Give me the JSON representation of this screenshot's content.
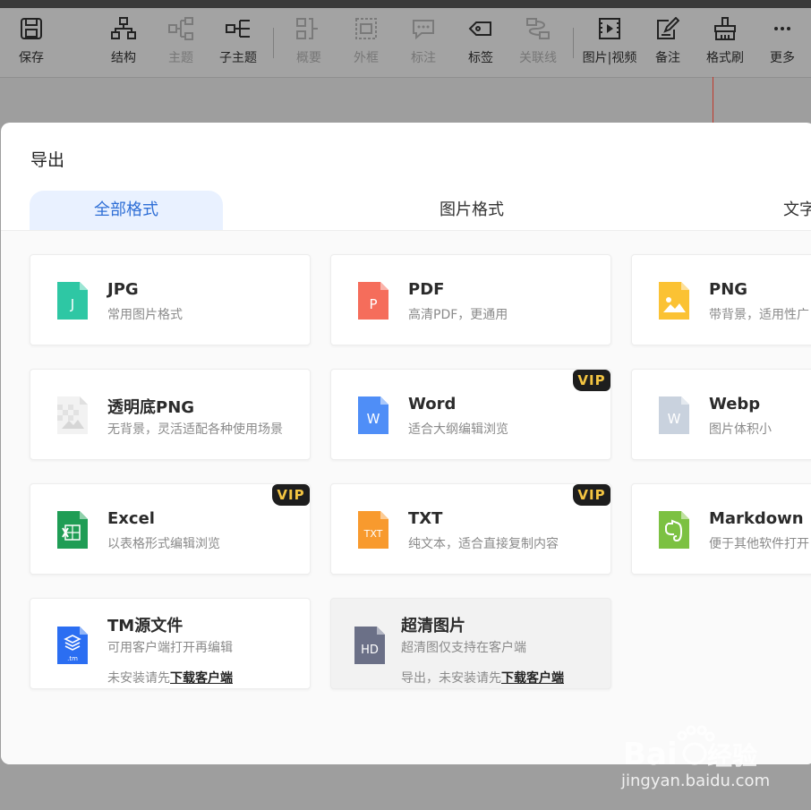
{
  "toolbar": {
    "items": [
      {
        "label": "保存",
        "icon": "save-icon",
        "enabled": true
      },
      {
        "label": "结构",
        "icon": "structure-icon",
        "enabled": true
      },
      {
        "label": "主题",
        "icon": "topic-icon",
        "enabled": false
      },
      {
        "label": "子主题",
        "icon": "subtopic-icon",
        "enabled": true
      },
      {
        "label": "概要",
        "icon": "summary-icon",
        "enabled": false
      },
      {
        "label": "外框",
        "icon": "boundary-icon",
        "enabled": false
      },
      {
        "label": "标注",
        "icon": "callout-icon",
        "enabled": false
      },
      {
        "label": "标签",
        "icon": "tag-icon",
        "enabled": true
      },
      {
        "label": "关联线",
        "icon": "relation-line-icon",
        "enabled": false
      },
      {
        "label": "图片|视频",
        "icon": "video-icon",
        "enabled": true
      },
      {
        "label": "备注",
        "icon": "note-icon",
        "enabled": true
      },
      {
        "label": "格式刷",
        "icon": "format-brush-icon",
        "enabled": true
      },
      {
        "label": "更多",
        "icon": "more-icon",
        "enabled": true
      }
    ]
  },
  "dialog": {
    "title": "导出",
    "tabs": [
      {
        "label": "全部格式",
        "active": true
      },
      {
        "label": "图片格式",
        "active": false
      },
      {
        "label": "文字",
        "active": false
      }
    ],
    "formats": [
      {
        "name": "JPG",
        "desc": "常用图片格式",
        "icon_label": "J",
        "icon": "jpg-file-icon",
        "color": "#2ec7a4"
      },
      {
        "name": "PDF",
        "desc": "高清PDF，更通用",
        "icon_label": "P",
        "icon": "pdf-file-icon",
        "color": "#f56d5b"
      },
      {
        "name": "PNG",
        "desc": "带背景，适用性广",
        "icon": "png-image-file-icon",
        "color": "#fbc234"
      },
      {
        "name": "透明底PNG",
        "desc": "无背景，灵活适配各种使用场景",
        "icon": "transparent-png-file-icon",
        "color": "#e3e3e3"
      },
      {
        "name": "Word",
        "desc": "适合大纲编辑浏览",
        "vip": "VIP",
        "icon_label": "W",
        "icon": "word-file-icon",
        "color": "#4f8ef7"
      },
      {
        "name": "Webp",
        "desc": "图片体积小",
        "icon_label": "W",
        "icon": "webp-file-icon",
        "color": "#c9d2de"
      },
      {
        "name": "Excel",
        "desc": "以表格形式编辑浏览",
        "vip": "VIP",
        "icon": "excel-file-icon",
        "color": "#1f9d55"
      },
      {
        "name": "TXT",
        "desc": "纯文本，适合直接复制内容",
        "vip": "VIP",
        "icon_label": "TXT",
        "icon": "txt-file-icon",
        "color": "#f89a2e"
      },
      {
        "name": "Markdown",
        "desc": "便于其他软件打开",
        "icon": "markdown-evernote-file-icon",
        "color": "#7cc142"
      },
      {
        "name": "TM源文件",
        "desc": "可用客户端打开再编辑",
        "desc2_prefix": "未安装请先",
        "download_link": "下载客户端",
        "icon_label": ".tm",
        "icon": "tm-file-icon",
        "color": "#2b6ef2"
      },
      {
        "name": "超清图片",
        "desc": "超清图仅支持在客户端",
        "desc2_prefix": "导出，未安装请先",
        "download_link": "下载客户端",
        "icon_label": "HD",
        "icon": "hd-image-file-icon",
        "color": "#6b7087",
        "disabled": true
      }
    ]
  },
  "watermark": {
    "text": "jingyan.baidu.com"
  }
}
